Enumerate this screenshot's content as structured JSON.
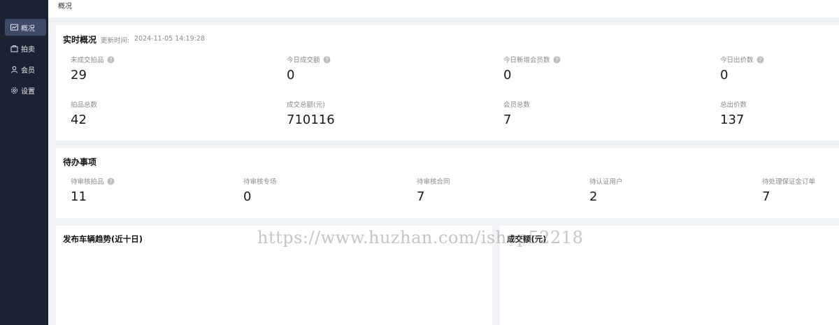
{
  "topbar": {
    "breadcrumb": "概况"
  },
  "sidebar": {
    "items": [
      {
        "label": "概况",
        "icon": "chart-icon",
        "active": true
      },
      {
        "label": "拍卖",
        "icon": "auction-icon",
        "active": false
      },
      {
        "label": "会员",
        "icon": "user-icon",
        "active": false
      },
      {
        "label": "设置",
        "icon": "gear-icon",
        "active": false
      }
    ]
  },
  "realtime": {
    "title": "实时概况",
    "updated_label": "更新时间:",
    "updated_time": "2024-11-05 14:19:28",
    "stats": [
      {
        "label": "未成交拍品",
        "value": "29",
        "help": true
      },
      {
        "label": "今日成交额",
        "value": "0",
        "help": true
      },
      {
        "label": "今日新增会员数",
        "value": "0",
        "help": true
      },
      {
        "label": "今日出价数",
        "value": "0",
        "help": true
      },
      {
        "label": "拍品总数",
        "value": "42",
        "help": false
      },
      {
        "label": "成交总额(元)",
        "value": "710116",
        "help": false
      },
      {
        "label": "会员总数",
        "value": "7",
        "help": false
      },
      {
        "label": "总出价数",
        "value": "137",
        "help": false
      }
    ]
  },
  "todo": {
    "title": "待办事项",
    "items": [
      {
        "label": "待审核拍品",
        "value": "11",
        "help": true
      },
      {
        "label": "待审核专场",
        "value": "0",
        "help": false
      },
      {
        "label": "待审核合同",
        "value": "7",
        "help": false
      },
      {
        "label": "待认证用户",
        "value": "2",
        "help": false
      },
      {
        "label": "待处理保证金订单",
        "value": "7",
        "help": false
      }
    ]
  },
  "charts": {
    "left_title": "发布车辆趋势(近十日)",
    "right_title": "成交额(元)"
  },
  "watermark": "https://www.huzhan.com/ishop52218",
  "colors": {
    "sidebar_bg": "#1b2333",
    "sidebar_active": "#3d4a66",
    "page_bg": "#f0f2f5"
  }
}
